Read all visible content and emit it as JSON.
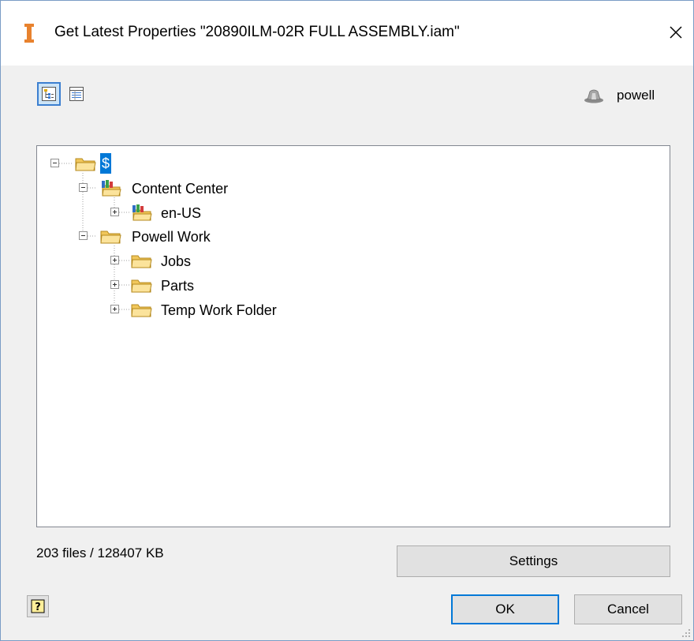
{
  "window": {
    "title": "Get Latest Properties \"20890ILM-02R FULL ASSEMBLY.iam\"",
    "close_icon": "close-icon"
  },
  "toolbar": {
    "tree_view_icon": "tree-view-icon",
    "list_view_icon": "list-view-icon",
    "tree_view_active": true
  },
  "user": {
    "icon": "vault-user-icon",
    "name": "powell"
  },
  "tree": {
    "root": {
      "label": "$",
      "selected": true,
      "expanded": true
    },
    "items": [
      {
        "label": "Content Center",
        "icon": "library-folder-icon",
        "expanded": true
      },
      {
        "label": "en-US",
        "icon": "library-folder-icon",
        "expanded": false
      },
      {
        "label": "Powell Work",
        "icon": "folder-icon",
        "expanded": true
      },
      {
        "label": "Jobs",
        "icon": "folder-icon",
        "expanded": false
      },
      {
        "label": "Parts",
        "icon": "folder-icon",
        "expanded": false
      },
      {
        "label": "Temp Work Folder",
        "icon": "folder-icon",
        "expanded": false
      }
    ]
  },
  "status": {
    "summary": "203 files / 128407 KB"
  },
  "buttons": {
    "settings": "Settings",
    "ok": "OK",
    "cancel": "Cancel",
    "help_icon": "help-icon"
  },
  "colors": {
    "selection": "#0078d7",
    "folder": "#f5d77c",
    "dialog_bg": "#f0f0f0"
  }
}
